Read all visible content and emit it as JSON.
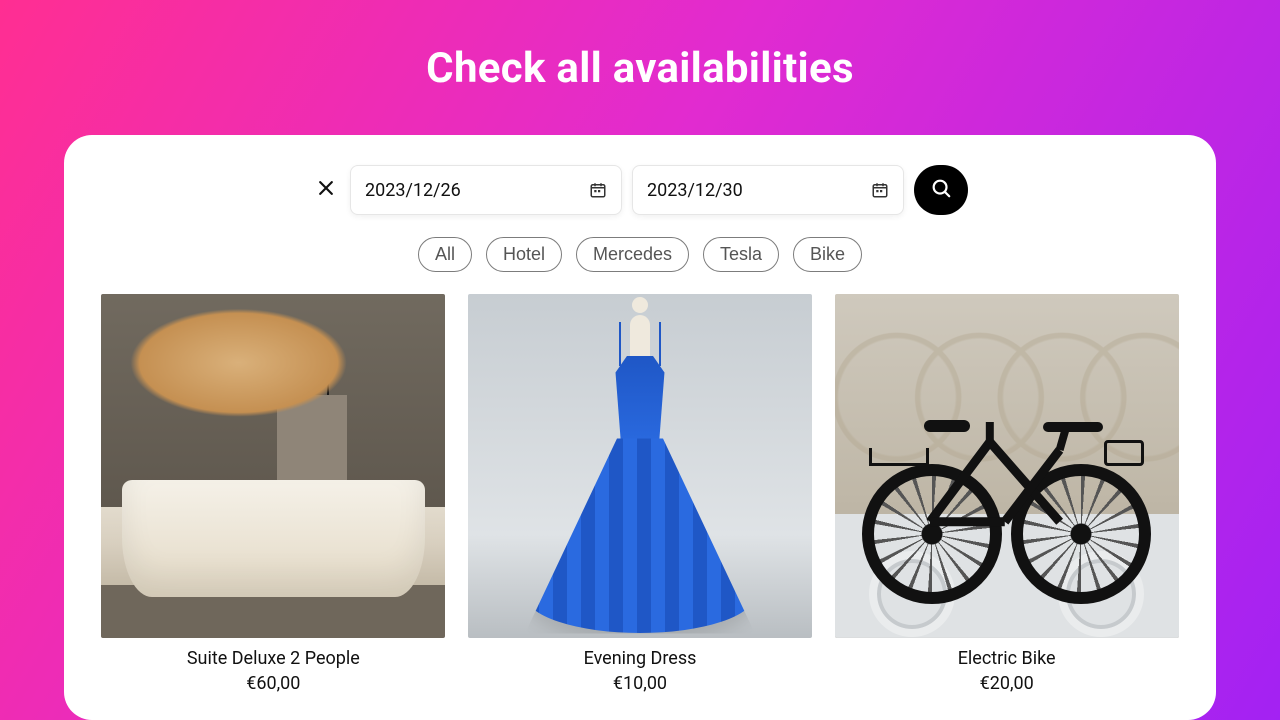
{
  "title": "Check all availabilities",
  "search": {
    "start_date": "2023/12/26",
    "end_date": "2023/12/30"
  },
  "filters": [
    "All",
    "Hotel",
    "Mercedes",
    "Tesla",
    "Bike"
  ],
  "products": [
    {
      "name": "Suite Deluxe 2 People",
      "price": "€60,00",
      "image": "hotel-room"
    },
    {
      "name": "Evening Dress",
      "price": "€10,00",
      "image": "blue-dress"
    },
    {
      "name": "Electric Bike",
      "price": "€20,00",
      "image": "electric-bike"
    }
  ],
  "colors": {
    "accent": "#000000",
    "gradient_from": "#ff2e92",
    "gradient_to": "#a322f3"
  }
}
